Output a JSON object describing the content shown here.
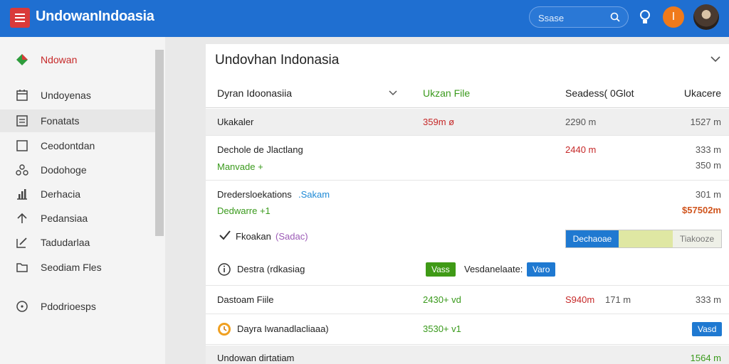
{
  "app": {
    "title": "UndowanIndoasia"
  },
  "search": {
    "label": "Ssase"
  },
  "user": {
    "avatar_initial": "I"
  },
  "sidebar": {
    "items": [
      {
        "label": "Ndowan",
        "icon": "diamond-logo-icon"
      },
      {
        "label": "Undoyenas",
        "icon": "calendar-icon"
      },
      {
        "label": "Fonatats",
        "icon": "document-icon"
      },
      {
        "label": "Ceodontdan",
        "icon": "square-icon"
      },
      {
        "label": "Dodohoge",
        "icon": "cluster-icon"
      },
      {
        "label": "Derhacia",
        "icon": "bar-chart-icon"
      },
      {
        "label": "Pedansiaa",
        "icon": "arrow-up-icon"
      },
      {
        "label": "Tadudarlaa",
        "icon": "edit-icon"
      },
      {
        "label": "Seodiam Fles",
        "icon": "folder-icon"
      },
      {
        "label": "Pdodrioesps",
        "icon": "circle-dot-icon"
      }
    ]
  },
  "panel": {
    "title": "Undovhan Indonasia",
    "header": {
      "col1": "Dyran Idoonasiia",
      "col2": "Ukzan File",
      "col3": "Seadess( 0Glot",
      "col4": "Ukacere"
    },
    "rows": {
      "r1": {
        "name": "Ukakaler",
        "v1": "359m ø",
        "v2": "2290 m",
        "v3": "1527 m"
      },
      "r2": {
        "name": "Dechole de Jlactlang",
        "sub": "Manvade +",
        "v2": "2440 m",
        "v3a": "333 m",
        "v3b": "350 m"
      },
      "r3": {
        "name": "Dredersloekations",
        "name_link": ".Sakam",
        "sub": "Dedwarre +1",
        "v3a": "301 m",
        "v3b": "$57502m"
      },
      "r4": {
        "name": "Fkoakan",
        "name_tag": "(Sadac)",
        "progress_button": "Dechaoae",
        "progress_label": "Tiakooze",
        "progress_fraction": 0.35
      },
      "r5": {
        "name": "Destra (rdkasiag",
        "badge_green": "Vass",
        "status_label": "Vesdanelaate:",
        "badge_blue": "Varo"
      },
      "r6": {
        "name": "Dastoam Fiile",
        "v1": "2430+ vd",
        "v2a": "S940m",
        "v2b": "171 m",
        "v3": "333 m"
      },
      "r7": {
        "name": "Dayra Iwanadlacliaaa)",
        "v1": "3530+ v1",
        "badge_blue": "Vasd"
      },
      "r8": {
        "name": "Undowan dirtatiam",
        "v3": "1564 m"
      }
    }
  },
  "colors": {
    "topbar": "#1f6fd1",
    "accent_red": "#d93a3a",
    "avatar": "#f07a1b",
    "green": "#3a9a1c",
    "blue": "#1f79d1"
  }
}
